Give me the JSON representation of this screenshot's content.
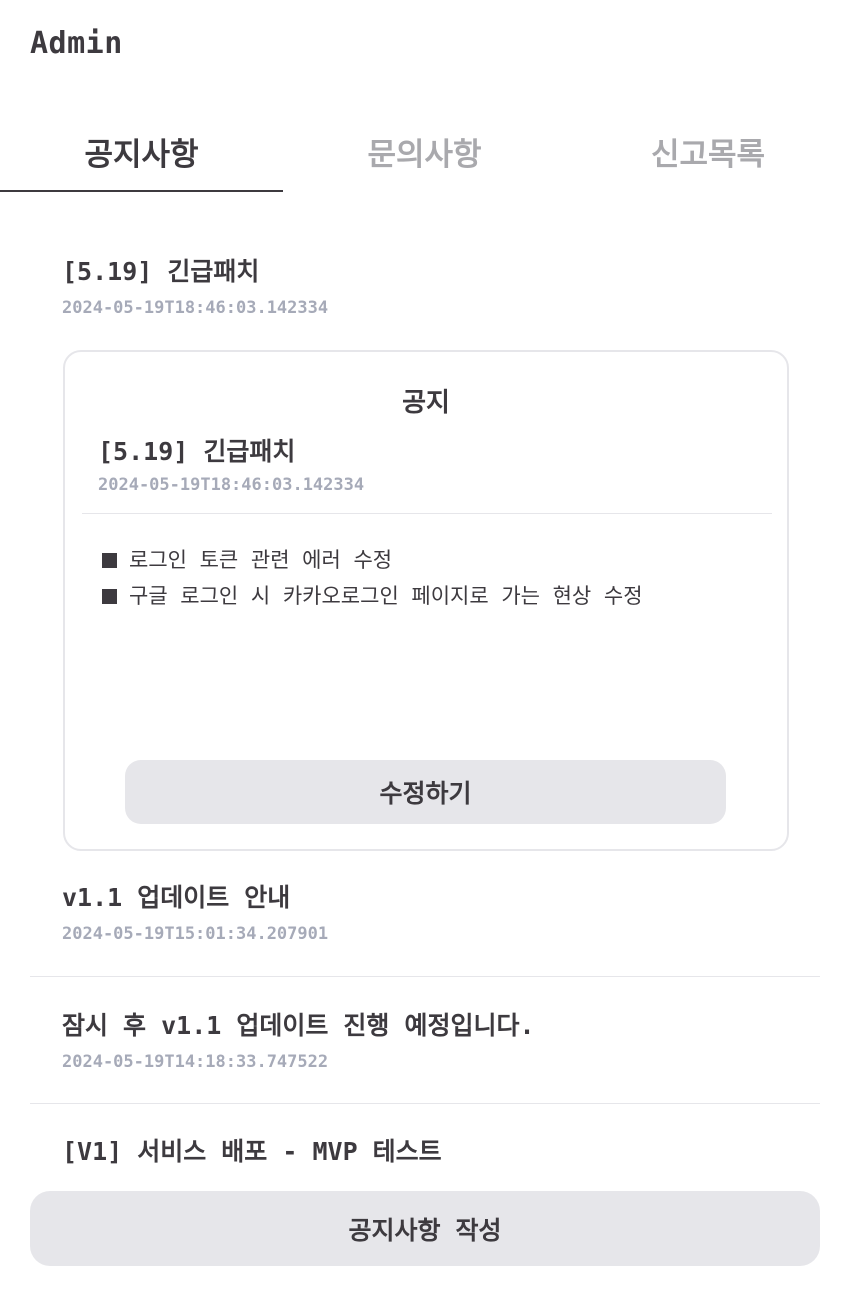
{
  "header": {
    "title": "Admin"
  },
  "tabs": [
    {
      "label": "공지사항",
      "active": true
    },
    {
      "label": "문의사항",
      "active": false
    },
    {
      "label": "신고목록",
      "active": false
    }
  ],
  "notices": [
    {
      "title": "[5.19] 긴급패치",
      "date": "2024-05-19T18:46:03.142334"
    },
    {
      "title": "v1.1 업데이트 안내",
      "date": "2024-05-19T15:01:34.207901"
    },
    {
      "title": "잠시 후 v1.1 업데이트 진행 예정입니다.",
      "date": "2024-05-19T14:18:33.747522"
    },
    {
      "title": "[V1] 서비스 배포 - MVP 테스트"
    }
  ],
  "detail": {
    "heading": "공지",
    "title": "[5.19] 긴급패치",
    "date": "2024-05-19T18:46:03.142334",
    "lines": [
      "로그인 토큰 관련 에러 수정",
      "구글 로그인 시 카카오로그인 페이지로 가는 현상 수정"
    ],
    "edit_label": "수정하기"
  },
  "actions": {
    "write_label": "공지사항 작성"
  },
  "colors": {
    "text": "#3d3a3f",
    "muted": "#a9a9ad",
    "date": "#a6aab8",
    "button_bg": "#e6e6ea",
    "border": "#e6e6ea"
  }
}
